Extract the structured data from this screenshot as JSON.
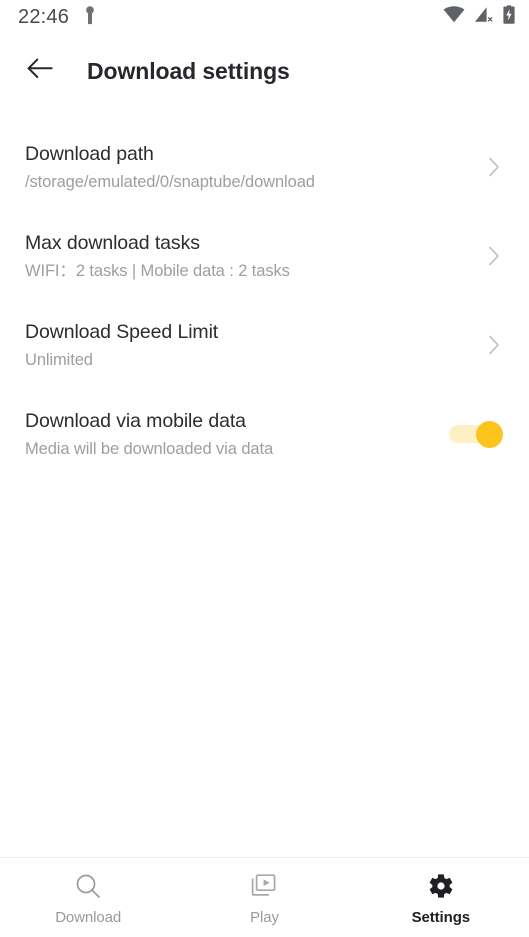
{
  "statusbar": {
    "time": "22:46",
    "icons": [
      {
        "name": "notification-icon"
      },
      {
        "name": "wifi-icon"
      },
      {
        "name": "cellular-signal-off-icon"
      },
      {
        "name": "battery-charging-icon"
      }
    ]
  },
  "appbar": {
    "back_icon": "arrow-left-icon",
    "title": "Download settings"
  },
  "settings": {
    "rows": [
      {
        "name": "download-path",
        "title": "Download path",
        "subtitle": "/storage/emulated/0/snaptube/download",
        "accessory": "chevron-right-icon"
      },
      {
        "name": "max-download-tasks",
        "title": "Max download tasks",
        "subtitle": "WIFI：2 tasks | Mobile data : 2 tasks",
        "accessory": "chevron-right-icon"
      },
      {
        "name": "download-speed-limit",
        "title": "Download Speed Limit",
        "subtitle": "Unlimited",
        "accessory": "chevron-right-icon"
      },
      {
        "name": "download-via-mobile-data",
        "title": "Download via mobile data",
        "subtitle": "Media will be downloaded via data",
        "accessory": "toggle-switch",
        "toggle_on": true
      }
    ]
  },
  "bottomnav": {
    "items": [
      {
        "name": "tab-download",
        "label": "Download",
        "icon": "search-icon",
        "active": false
      },
      {
        "name": "tab-play",
        "label": "Play",
        "icon": "video-library-icon",
        "active": false
      },
      {
        "name": "tab-settings",
        "label": "Settings",
        "icon": "gear-icon",
        "active": true
      }
    ]
  },
  "colors": {
    "accent": "#FBC51E",
    "accent_track": "#FDF0C4",
    "title": "#2B2D30",
    "subtitle": "#9C9EA1",
    "inactive_nav": "#9A9A9A"
  }
}
